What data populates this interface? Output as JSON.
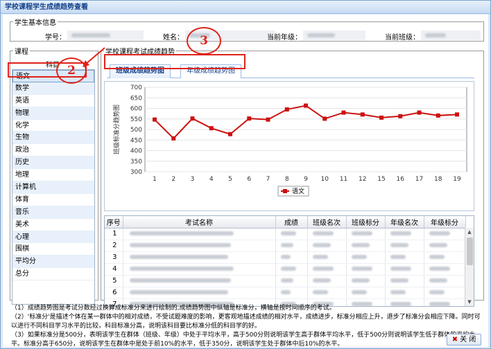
{
  "window": {
    "title": "学校课程学生成绩趋势查看"
  },
  "basic": {
    "legend": "学生基本信息",
    "student_id_label": "学号：",
    "name_label": "姓名：",
    "grade_label": "当前年级：",
    "class_label": "当前班级："
  },
  "course": {
    "legend": "课程",
    "header": "科目",
    "items": [
      "语文",
      "数学",
      "英语",
      "物理",
      "化学",
      "生物",
      "政治",
      "历史",
      "地理",
      "计算机",
      "体育",
      "音乐",
      "美术",
      "心理",
      "围棋",
      "平均分",
      "总分"
    ],
    "selected": "语文"
  },
  "trend": {
    "legend": "学校课程考试成绩趋势",
    "tabs": [
      "班级成绩趋势图",
      "年级成绩趋势图"
    ],
    "active_tab": "班级成绩趋势图"
  },
  "chart_data": {
    "type": "line",
    "title": "",
    "xlabel": "",
    "ylabel": "班级标准分趋势图",
    "x": [
      1,
      2,
      3,
      4,
      5,
      6,
      7,
      8,
      9,
      10,
      11,
      12,
      15,
      16,
      17,
      18,
      19
    ],
    "series": [
      {
        "name": "语文",
        "color": "#cc1111",
        "values": [
          547,
          458,
          552,
          506,
          478,
          552,
          547,
          595,
          613,
          551,
          580,
          571,
          556,
          563,
          580,
          566,
          571
        ]
      }
    ],
    "yticks": [
      300,
      350,
      400,
      450,
      500,
      550,
      600,
      650,
      700
    ],
    "ylim": [
      300,
      700
    ],
    "grid": true,
    "legend": "bottom"
  },
  "table": {
    "columns": [
      "序号",
      "考试名称",
      "成绩",
      "班级名次",
      "班级标分",
      "年级名次",
      "年级标分"
    ],
    "rows": [
      "1",
      "2",
      "3",
      "4",
      "5",
      "6",
      "7",
      "8"
    ]
  },
  "notes": [
    "（1）成绩趋势图是考试分数经过换算成标准分来进行绘制的,成绩趋势图中纵轴是标准分，横轴是按时间顺序的考试。",
    "（2）'标准分'是描述个体在某一群体中的相对成绩，不受试题难度的影响，更客观地描述成绩的相对水平，成绩进步，标准分相应上升，退步了标准分会相应下降。同时可以进行不同科目学习水平的比较，科目标准分高，说明该科目要比标准分低的科目学的好。",
    "（3）如果标准分是500分，表明该学生在群体（班级、年级）中处于平均水平，高于500分则说明该学生高于群体平均水平，低于500分则说明该学生低于群体的平均水平。标准分高于650分，说明该学生在群体中是处于前10%的水平，低于350分，说明该学生处于群体中后10%的水平。"
  ],
  "close_label": "关 闭",
  "annotations": [
    "2",
    "3"
  ],
  "colors": {
    "accent": "#15428b",
    "annotation": "#e0221a",
    "series": "#cc1111"
  }
}
